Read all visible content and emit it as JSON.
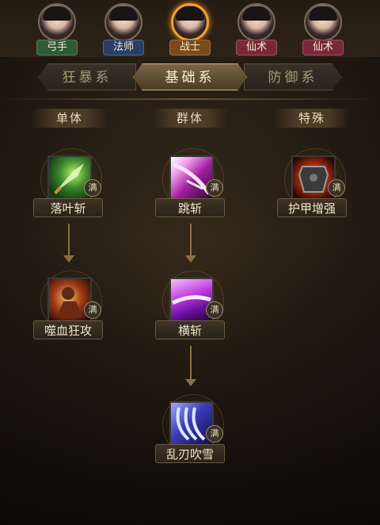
{
  "classes": [
    {
      "label": "弓手",
      "color": "#2f5a36",
      "active": false
    },
    {
      "label": "法师",
      "color": "#2a3f66",
      "active": false
    },
    {
      "label": "战士",
      "color": "#7a4a1c",
      "active": true
    },
    {
      "label": "仙术",
      "color": "#7a2838",
      "active": false
    },
    {
      "label": "仙术",
      "color": "#7a2838",
      "active": false
    }
  ],
  "tabs": [
    {
      "label": "狂暴系",
      "active": false
    },
    {
      "label": "基础系",
      "active": true
    },
    {
      "label": "防御系",
      "active": false
    }
  ],
  "columns": [
    "单体",
    "群体",
    "特殊"
  ],
  "skills": [
    {
      "name": "落叶斩",
      "badge": "满",
      "icon": "green-sword-slash-icon"
    },
    {
      "name": "跳斩",
      "badge": "满",
      "icon": "purple-leap-slash-icon"
    },
    {
      "name": "护甲增强",
      "badge": "满",
      "icon": "armor-boost-icon"
    },
    {
      "name": "噬血狂攻",
      "badge": "满",
      "icon": "bloodthirst-warrior-icon"
    },
    {
      "name": "横斩",
      "badge": "满",
      "icon": "horizontal-slash-icon"
    },
    {
      "name": "乱刃吹雪",
      "badge": "满",
      "icon": "blade-blizzard-icon"
    }
  ]
}
